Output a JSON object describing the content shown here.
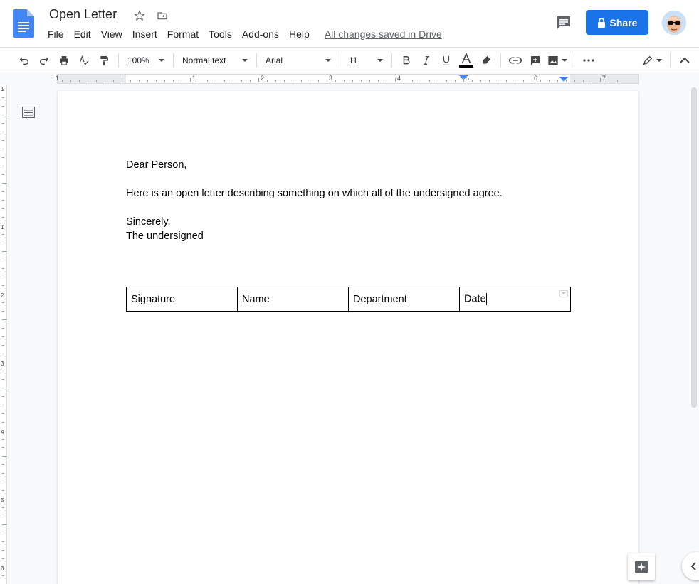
{
  "app": {
    "doc_title": "Open Letter",
    "status": "All changes saved in Drive",
    "share_label": "Share",
    "accent": "#1a73e8"
  },
  "menu": [
    "File",
    "Edit",
    "View",
    "Insert",
    "Format",
    "Tools",
    "Add-ons",
    "Help"
  ],
  "toolbar": {
    "zoom": "100%",
    "style": "Normal text",
    "font": "Arial",
    "size": "11"
  },
  "ruler": {
    "h_numbers": [
      "1",
      "1",
      "2",
      "3",
      "4",
      "5",
      "6",
      "7"
    ],
    "v_numbers": [
      "1",
      "1",
      "2",
      "3",
      "4",
      "5",
      "6"
    ]
  },
  "document": {
    "greeting": "Dear Person,",
    "body": "Here is an open letter describing something on which all of the undersigned agree.",
    "closing": "Sincerely,",
    "signoff": "The undersigned",
    "table_headers": [
      "Signature",
      "Name",
      "Department",
      "Date"
    ]
  },
  "icons": {
    "star": "star-icon",
    "move": "move-to-folder-icon",
    "comment": "comment-icon",
    "lock": "lock-icon",
    "outline": "document-outline-icon",
    "explore": "explore-icon"
  }
}
